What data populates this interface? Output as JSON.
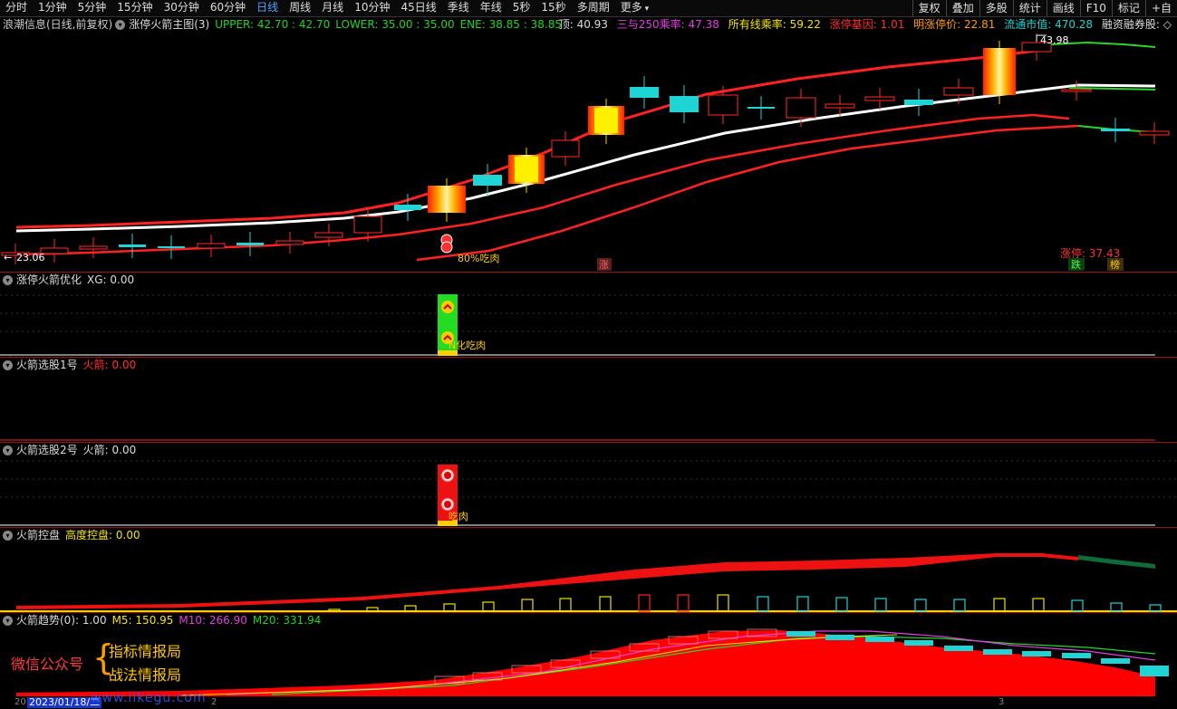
{
  "toolbar": {
    "periods": [
      "分时",
      "1分钟",
      "5分钟",
      "15分钟",
      "30分钟",
      "60分钟",
      "日线",
      "周线",
      "月线",
      "10分钟",
      "45日线",
      "季线",
      "年线",
      "5秒",
      "15秒",
      "多周期",
      "更多"
    ],
    "active": "日线",
    "tools": [
      "复权",
      "叠加",
      "多股",
      "统计",
      "画线",
      "F10",
      "标记",
      "+自"
    ]
  },
  "main": {
    "stock": "浪潮信息(日线,前复权)",
    "indicator": "涨停火箭主图(3)",
    "upper_label": "UPPER: 42.70 : 42.70",
    "lower_label": "LOWER: 35.00 : 35.00",
    "ene_label": "ENE: 38.85 : 38.85",
    "top_label": "顶: 40.93",
    "ratio250_label": "三与250乘率: 47.38",
    "allratio_label": "所有线乘率: 59.22",
    "gene_label": "涨停基因: 1.01",
    "nextlimit_label": "明涨停价: 22.81",
    "float_label": "流通市值: 470.28",
    "margin_label": "融资融券股: ◇",
    "high_mark": "43.98",
    "low_mark": "23.06",
    "limit_label": "涨停: 37.43",
    "zhang": "涨",
    "die": "跌",
    "bang": "榜",
    "eat_text": "80%吃肉"
  },
  "panel1": {
    "title": "涨停火箭优化",
    "value": "XG: 0.00",
    "eat_text": "N化吃肉"
  },
  "panel2": {
    "title": "火箭选股1号",
    "value": "火箭: 0.00"
  },
  "panel3": {
    "title": "火箭选股2号",
    "value": "火箭: 0.00",
    "eat_text": "吃肉"
  },
  "panel4": {
    "title": "火箭控盘",
    "value": "高度控盘: 0.00"
  },
  "panel5": {
    "title": "火箭趋势(0)",
    "val": ": 1.00",
    "m5": "M5: 150.95",
    "m10": "M10: 266.90",
    "m20": "M20: 331.94"
  },
  "watermark": {
    "line1": "微信公众号",
    "line2": "指标情报局",
    "line3": "战法情报局",
    "url": "www.iikegu.com"
  },
  "datebar": {
    "date": "2023/01/18/二",
    "tick_left": "20",
    "tick_2": "2",
    "tick_3": "3"
  },
  "colors": {
    "up": "#ff2a2a",
    "down": "#1fd4d4",
    "bg": "#000000",
    "ma_white": "#ffffff",
    "ma_green": "#2bd52b"
  }
}
